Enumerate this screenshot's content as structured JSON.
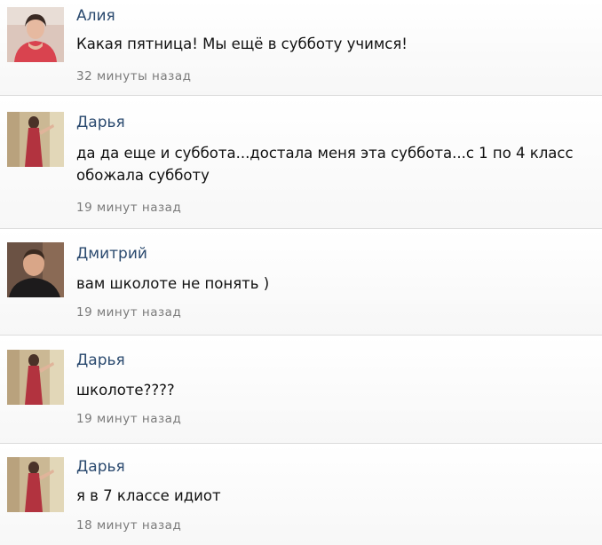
{
  "comments": [
    {
      "author": "Алия",
      "text": "Какая пятница! Мы ещё в субботу учимся!",
      "time": "32 минуты назад",
      "avatar_icon": "user-photo-girl-red-top",
      "avatar_bg": "#d9c3b8"
    },
    {
      "author": "Дарья",
      "text": "да да еще и суббота...достала меня эта суббота...с 1 по 4 класс обожала субботу",
      "time": "19 минут назад",
      "avatar_icon": "user-photo-girl-red-dress",
      "avatar_bg": "#c9b693"
    },
    {
      "author": "Дмитрий",
      "text": "вам школоте не понять )",
      "time": "19 минут назад",
      "avatar_icon": "user-photo-man-dark-shirt",
      "avatar_bg": "#6a5244"
    },
    {
      "author": "Дарья",
      "text": "школоте????",
      "time": "19 минут назад",
      "avatar_icon": "user-photo-girl-red-dress",
      "avatar_bg": "#c9b693"
    },
    {
      "author": "Дарья",
      "text": "я в 7 классе идиот",
      "time": "18 минут назад",
      "avatar_icon": "user-photo-girl-red-dress",
      "avatar_bg": "#c9b693"
    }
  ],
  "colors": {
    "author_link": "#2b4a6f",
    "text": "#111111",
    "timestamp": "#7a7a7a",
    "divider": "#dcdcdc"
  }
}
